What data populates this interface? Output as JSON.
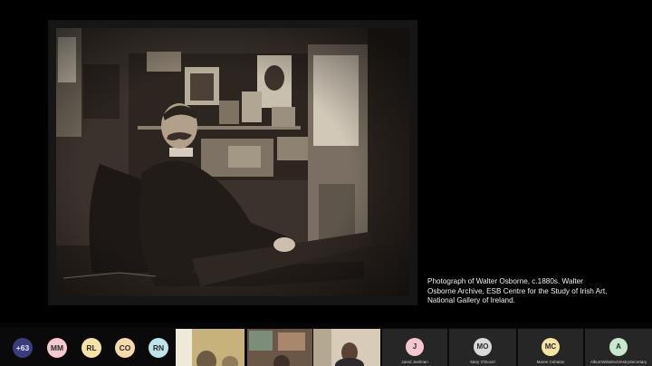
{
  "presentation": {
    "caption": "Photograph of Walter Osborne, c.1880s. Walter Osborne Archive, ESB Centre for the Study of Irish Art, National Gallery of Ireland."
  },
  "participants": {
    "overflow_badge": "+63",
    "avatars": [
      {
        "initials": "MM",
        "color": "#f5c9cf"
      },
      {
        "initials": "RL",
        "color": "#f4e3a2"
      },
      {
        "initials": "CO",
        "color": "#f6d9a8"
      },
      {
        "initials": "RN",
        "color": "#bfe3ea"
      }
    ],
    "video_tiles": [
      {
        "label": "video-participant-1"
      },
      {
        "label": "video-participant-2"
      },
      {
        "label": "video-participant-3"
      }
    ],
    "tiles": [
      {
        "initials": "J",
        "name": "Jared Jeelman",
        "color": "#f4c6ce"
      },
      {
        "initials": "MO",
        "name": "Mary O'Donel",
        "color": "#d9d9d9"
      },
      {
        "initials": "MC",
        "name": "Maree Cahalan",
        "color": "#f4e3a2"
      },
      {
        "initials": "A",
        "name": "AlbumWiSelectVestrySecretary",
        "color": "#c7e7cf"
      }
    ]
  }
}
